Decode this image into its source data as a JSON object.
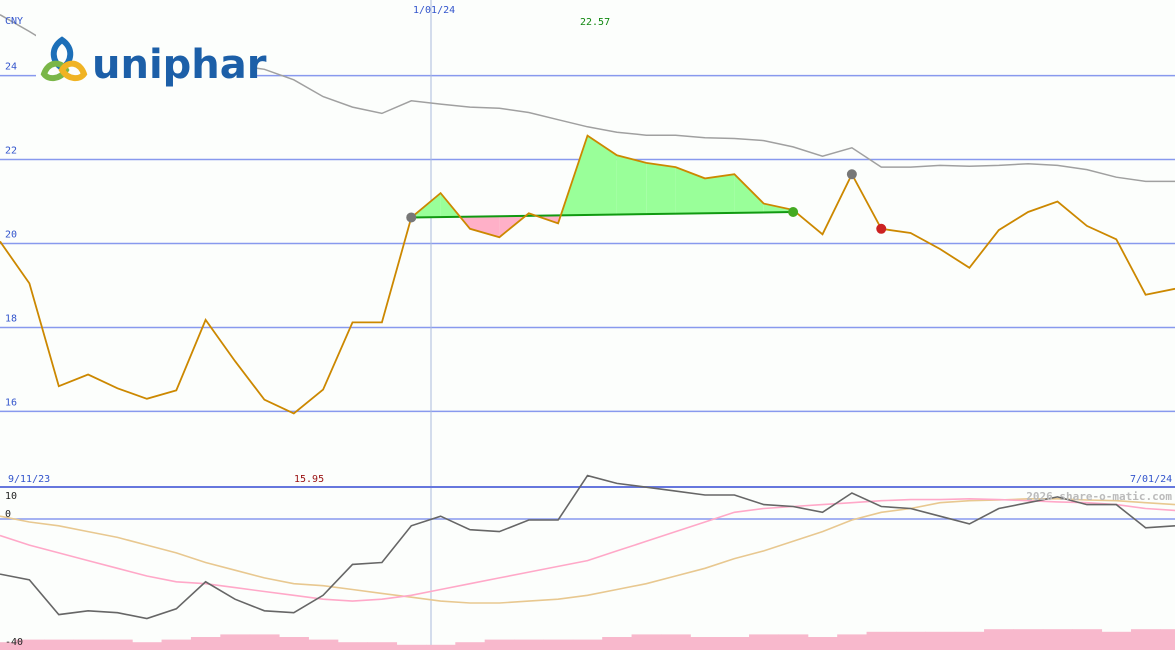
{
  "brand": {
    "name": "uniphar"
  },
  "currency_label": "CNY",
  "cursor_date": "1/01/24",
  "high_label": "22.57",
  "low_label": "15.95",
  "start_date": "9/11/23",
  "end_date": "7/01/24",
  "copyright": "2026 share-o-matic.com",
  "colors": {
    "price": "#cc8800",
    "moving_average": "#a0a0a0",
    "gridline": "#8899ee",
    "gain_fill": "#99ff99",
    "loss_fill": "#ffb0c8",
    "oscillator": "#666666",
    "oscillator_signal_pink": "#ffa8c8",
    "oscillator_signal_tan": "#e8c890",
    "volume": "#f8b8cc"
  },
  "chart_data": [
    {
      "type": "line",
      "title": "",
      "ylabel": "CNY",
      "ylim": [
        14.2,
        25.8
      ],
      "y_ticks": [
        16,
        18,
        20,
        22,
        24
      ],
      "grid": true,
      "x_index_range": [
        0,
        41
      ],
      "series": [
        {
          "role": "price",
          "values": [
            20.05,
            19.05,
            16.6,
            16.88,
            16.55,
            16.3,
            16.5,
            18.18,
            17.2,
            16.28,
            15.95,
            16.52,
            18.12,
            18.12,
            20.62,
            21.2,
            20.35,
            20.15,
            20.72,
            20.48,
            22.57,
            22.1,
            21.92,
            21.82,
            21.55,
            21.65,
            20.95,
            20.8,
            20.22,
            21.65,
            20.35,
            20.25,
            19.87,
            19.42,
            20.32,
            20.75,
            21.0,
            20.42,
            20.1,
            18.78,
            18.92
          ]
        },
        {
          "role": "moving_average",
          "values": [
            25.45,
            25.05,
            24.62,
            24.6,
            24.55,
            24.65,
            24.4,
            24.4,
            24.25,
            24.15,
            23.9,
            23.5,
            23.25,
            23.1,
            23.4,
            23.32,
            23.25,
            23.22,
            23.12,
            22.95,
            22.78,
            22.65,
            22.58,
            22.58,
            22.52,
            22.5,
            22.45,
            22.3,
            22.08,
            22.28,
            21.82,
            21.82,
            21.86,
            21.84,
            21.86,
            21.9,
            21.86,
            21.76,
            21.58,
            21.48,
            21.48
          ]
        }
      ],
      "trades": [
        {
          "entry_x": 14,
          "entry": 20.62,
          "exit_x": 27,
          "exit": 20.75,
          "result": "gain"
        },
        {
          "entry_x": 29,
          "entry": 21.65,
          "exit_x": 30,
          "exit": 20.35,
          "result": "loss"
        }
      ]
    },
    {
      "type": "line",
      "title": "",
      "ylim": [
        -40,
        10
      ],
      "y_ticks": [
        10,
        0,
        -40
      ],
      "series": [
        {
          "role": "oscillator",
          "values": [
            -18,
            -19.5,
            -28.5,
            -27.5,
            -28,
            -29.5,
            -27,
            -20,
            -24.5,
            -27.5,
            -28,
            -23.5,
            -15.5,
            -15,
            -5.5,
            -3,
            -6.5,
            -7,
            -4,
            -4,
            7.5,
            5.5,
            4.5,
            3.5,
            2.5,
            2.5,
            0,
            -0.5,
            -2,
            3,
            -0.5,
            -1,
            -3,
            -5,
            -1,
            0.5,
            2,
            0,
            0,
            -6,
            -5.5
          ]
        },
        {
          "role": "signal_pink",
          "values": [
            -8,
            -10.5,
            -12.5,
            -14.5,
            -16.5,
            -18.5,
            -20,
            -20.5,
            -21.5,
            -22.5,
            -23.5,
            -24.5,
            -25,
            -24.5,
            -23.5,
            -22,
            -20.5,
            -19,
            -17.5,
            -16,
            -14.5,
            -12,
            -9.5,
            -7,
            -4.5,
            -2,
            -1,
            -0.5,
            0,
            0.5,
            1,
            1.3,
            1.3,
            1.5,
            1.3,
            1,
            0.7,
            0.5,
            0,
            -1,
            -1.5
          ]
        },
        {
          "role": "signal_tan",
          "values": [
            -3,
            -4.5,
            -5.5,
            -7,
            -8.5,
            -10.5,
            -12.5,
            -15,
            -17,
            -19,
            -20.5,
            -21,
            -22,
            -23,
            -24,
            -25,
            -25.5,
            -25.5,
            -25,
            -24.5,
            -23.5,
            -22,
            -20.5,
            -18.5,
            -16.5,
            -14,
            -12,
            -9.5,
            -7,
            -4,
            -2,
            -1,
            0.5,
            1,
            1.2,
            1.5,
            1.5,
            1.2,
            1,
            0.5,
            0
          ]
        }
      ],
      "volume": [
        3,
        4,
        4,
        4,
        4,
        3,
        4,
        5,
        6,
        6,
        5,
        4,
        3,
        3,
        2,
        2,
        3,
        4,
        4,
        4,
        4,
        5,
        6,
        6,
        5,
        5,
        6,
        6,
        5,
        6,
        7,
        7,
        7,
        7,
        8,
        8,
        8,
        8,
        7,
        8,
        8
      ]
    }
  ]
}
